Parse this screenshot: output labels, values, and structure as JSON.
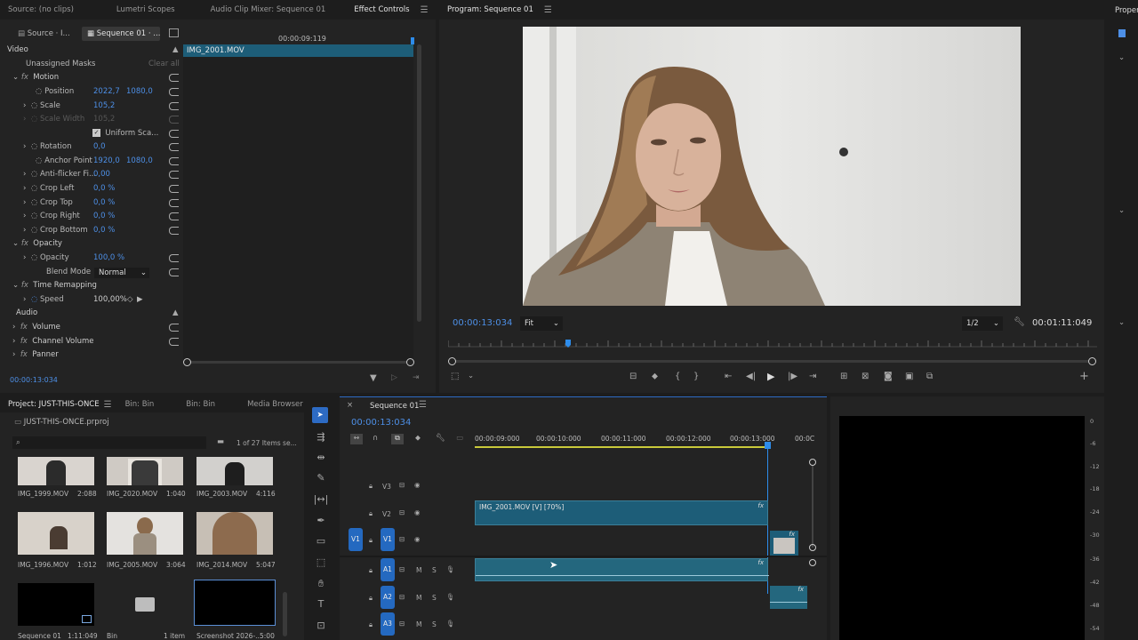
{
  "top_tabs": {
    "source": "Source: (no clips)",
    "lumetri": "Lumetri Scopes",
    "audio_mixer": "Audio Clip Mixer: Sequence 01",
    "effect_controls": "Effect Controls",
    "program": "Program: Sequence 01",
    "properties": "Proper"
  },
  "effect_controls": {
    "source_tab": "Source · I...",
    "sequence_tab": "Sequence 01 · ...",
    "timecode_ruler": "00:00:09:119",
    "clip_name": "IMG_2001.MOV",
    "video_header": "Video",
    "masks_label": "Unassigned Masks",
    "clear_all": "Clear all",
    "motion": "Motion",
    "position_label": "Position",
    "position_x": "2022,7",
    "position_y": "1080,0",
    "scale_label": "Scale",
    "scale_value": "105,2",
    "scale_width_label": "Scale Width",
    "scale_width_value": "105,2",
    "uniform_scale": "Uniform Sca...",
    "rotation_label": "Rotation",
    "rotation_value": "0,0",
    "anchor_label": "Anchor Point",
    "anchor_x": "1920,0",
    "anchor_y": "1080,0",
    "antiflicker_label": "Anti-flicker Fi...",
    "antiflicker_value": "0,00",
    "crop_left_label": "Crop Left",
    "crop_left_value": "0,0 %",
    "crop_top_label": "Crop Top",
    "crop_top_value": "0,0 %",
    "crop_right_label": "Crop Right",
    "crop_right_value": "0,0 %",
    "crop_bottom_label": "Crop Bottom",
    "crop_bottom_value": "0,0 %",
    "opacity_group": "Opacity",
    "opacity_label": "Opacity",
    "opacity_value": "100,0 %",
    "blend_label": "Blend Mode",
    "blend_value": "Normal",
    "time_remap": "Time Remapping",
    "speed_label": "Speed",
    "speed_value": "100,00%",
    "audio_header": "Audio",
    "volume": "Volume",
    "channel_volume": "Channel Volume",
    "panner": "Panner",
    "footer_timecode": "00:00:13:034"
  },
  "program": {
    "timecode": "00:00:13:034",
    "fit": "Fit",
    "resolution": "1/2",
    "duration": "00:01:11:049"
  },
  "project": {
    "tab_project": "Project: JUST-THIS-ONCE",
    "tab_bin1": "Bin: Bin",
    "tab_bin2": "Bin: Bin",
    "tab_media": "Media Browser",
    "file": "JUST-THIS-ONCE.prproj",
    "items_count": "1 of 27 Items se...",
    "clips": [
      {
        "name": "IMG_1999.MOV",
        "dur": "2:088"
      },
      {
        "name": "IMG_2020.MOV",
        "dur": "1:040"
      },
      {
        "name": "IMG_2003.MOV",
        "dur": "4:116"
      },
      {
        "name": "IMG_1996.MOV",
        "dur": "1:012"
      },
      {
        "name": "IMG_2005.MOV",
        "dur": "3:064"
      },
      {
        "name": "IMG_2014.MOV",
        "dur": "5:047"
      },
      {
        "name": "Sequence 01",
        "dur": "1:11:049"
      },
      {
        "name": "Bin",
        "dur": "1 item"
      },
      {
        "name": "Screenshot 2026-...",
        "dur": "5:00"
      }
    ]
  },
  "timeline": {
    "tab": "Sequence 01",
    "timecode": "00:00:13:034",
    "ruler": [
      "00:00:09:000",
      "00:00:10:000",
      "00:00:11:000",
      "00:00:12:000",
      "00:00:13:000",
      "00:0C"
    ],
    "tracks": {
      "v3": "V3",
      "v2": "V2",
      "v1": "V1",
      "a1": "A1",
      "a2": "A2",
      "a3": "A3",
      "m": "M",
      "s": "S"
    },
    "clip_label": "IMG_2001.MOV [V] [70%]",
    "fx": "fx"
  },
  "meter": {
    "ticks": [
      "0",
      "-6",
      "-12",
      "-18",
      "-24",
      "-30",
      "-36",
      "-42",
      "-48",
      "-54"
    ]
  },
  "colors": {
    "accent": "#2d8ceb",
    "clip_teal": "#1d5d78",
    "audio_teal": "#24677e",
    "panel": "#232323"
  }
}
